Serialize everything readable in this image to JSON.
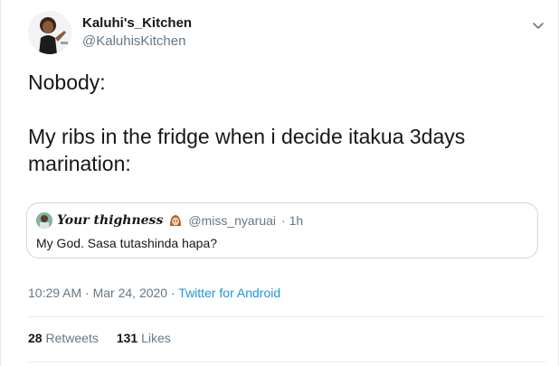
{
  "tweet": {
    "display_name": "Kaluhi's_Kitchen",
    "handle": "@KaluhisKitchen",
    "text_line1": "Nobody:",
    "text_line2": "My ribs in the fridge when i decide itakua 3days marination:",
    "timestamp": "10:29 AM · Mar 24, 2020",
    "separator": " · ",
    "source": "Twitter for Android",
    "retweets_count": "28",
    "retweets_label": "Retweets",
    "likes_count": "131",
    "likes_label": "Likes"
  },
  "quote": {
    "display_name": "Your thighness",
    "handle": "@miss_nyaruai",
    "time": "· 1h",
    "text": "My God. Sasa tutashinda hapa?"
  },
  "colors": {
    "text": "#14171a",
    "secondary": "#657786",
    "link": "#1b95e0",
    "border": "#ccd6dd"
  },
  "icons": {
    "caret": "chevron-down-icon",
    "quote_emoji": "woman-emoji-icon"
  }
}
